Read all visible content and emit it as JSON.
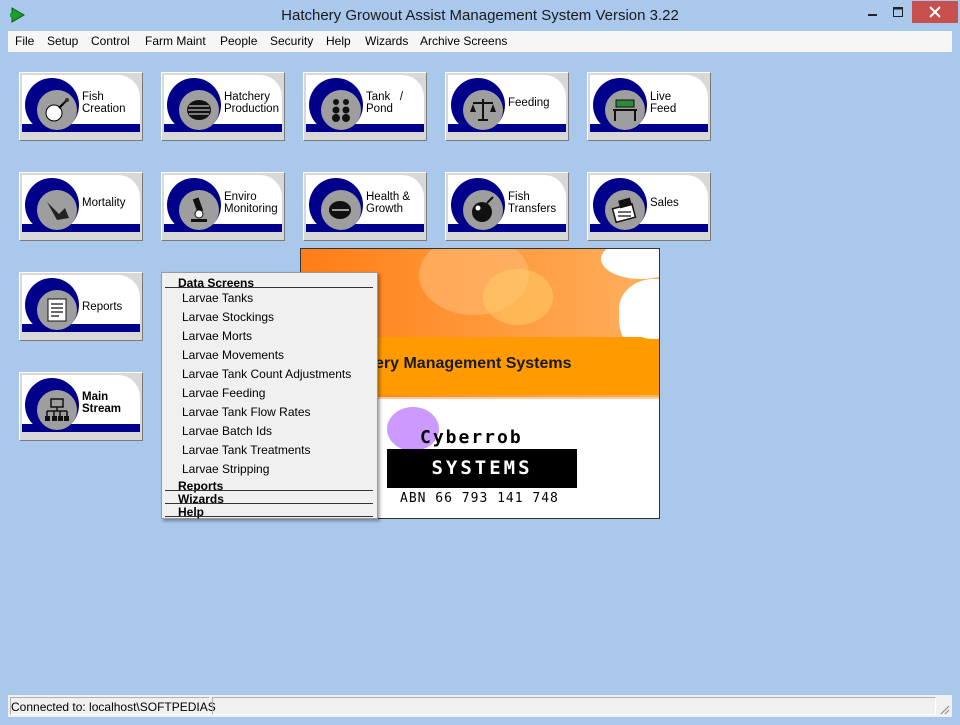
{
  "window": {
    "title": "Hatchery Growout Assist Management System Version 3.22"
  },
  "menu": {
    "items": [
      "File",
      "Setup",
      "Control",
      "Farm Maint",
      "People",
      "Security",
      "Help",
      "Wizards",
      "Archive Screens"
    ]
  },
  "tiles": [
    {
      "label_1": "Fish",
      "label_2": "Creation",
      "icon": "fish-hook-icon"
    },
    {
      "label_1": "Hatchery",
      "label_2": "Production",
      "icon": "basket-icon"
    },
    {
      "label_1": "Tank   /",
      "label_2": "Pond",
      "icon": "tanks-icon"
    },
    {
      "label_1": "Feeding",
      "label_2": "",
      "icon": "scale-icon"
    },
    {
      "label_1": "Live",
      "label_2": "Feed",
      "icon": "table-icon"
    },
    {
      "label_1": "Mortality",
      "label_2": "",
      "icon": "dead-fish-icon"
    },
    {
      "label_1": "Enviro",
      "label_2": "Monitoring",
      "icon": "microscope-icon"
    },
    {
      "label_1": "Health &",
      "label_2": "Growth",
      "icon": "fish-icon"
    },
    {
      "label_1": "Fish",
      "label_2": "Transfers",
      "icon": "transfer-icon"
    },
    {
      "label_1": "Sales",
      "label_2": "",
      "icon": "cash-register-icon"
    },
    {
      "label_1": "Reports",
      "label_2": "",
      "icon": "report-icon"
    },
    {
      "label_1": "Main",
      "label_2": "Stream",
      "icon": "hierarchy-icon"
    }
  ],
  "dropdown": {
    "section_data": "Data Screens",
    "items": [
      "Larvae Tanks",
      "Larvae Stockings",
      "Larvae Morts",
      "Larvae Movements",
      "Larvae Tank Count Adjustments",
      "Larvae Feeding",
      "Larvae Tank Flow Rates",
      "Larvae Batch Ids",
      "Larvae Tank Treatments",
      "Larvae Stripping"
    ],
    "section_reports": "Reports",
    "section_wizards": "Wizards",
    "section_help": "Help"
  },
  "splash": {
    "title": "tchery Management Systems",
    "company": "Cyberrob",
    "systems": "SYSTEMS",
    "abn": "ABN 66 793 141 748"
  },
  "status": {
    "connection": "Connected to: localhost\\SOFTPEDIAS"
  },
  "colors": {
    "background": "#a9c8ec",
    "tile_band": "#00008b",
    "close_button": "#c7504d",
    "splash_orange": "#ff9a00"
  }
}
